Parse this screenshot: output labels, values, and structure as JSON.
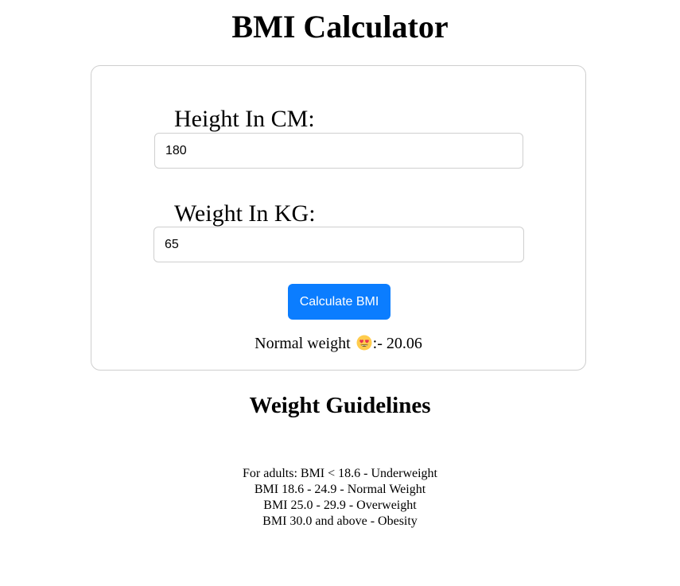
{
  "page": {
    "title": "BMI Calculator"
  },
  "form": {
    "height_label": "Height In CM:",
    "height_value": "180",
    "weight_label": "Weight In KG:",
    "weight_value": "65",
    "calculate_label": "Calculate BMI"
  },
  "result": {
    "category": "Normal weight",
    "emoji": "smiling-face-with-heart-eyes-icon",
    "value_text": ":- 20.06"
  },
  "guidelines": {
    "title": "Weight Guidelines",
    "lines": [
      "For adults: BMI < 18.6 - Underweight",
      "BMI 18.6 - 24.9 - Normal Weight",
      "BMI 25.0 - 29.9 - Overweight",
      "BMI 30.0 and above - Obesity"
    ]
  },
  "colors": {
    "button_bg": "#0b7dff",
    "button_text": "#ffffff",
    "card_border": "#cfcfcf",
    "emoji_face": "#ffcc4d",
    "emoji_hearts": "#e8344e"
  }
}
